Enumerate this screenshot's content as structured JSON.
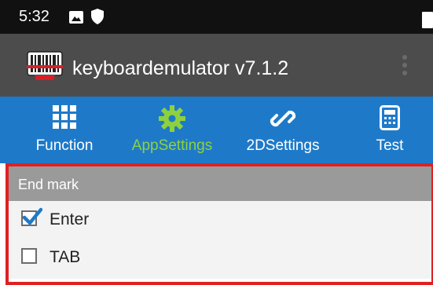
{
  "status_bar": {
    "time": "5:32",
    "icons": [
      "image-icon",
      "shield-icon",
      "battery-icon"
    ]
  },
  "app_bar": {
    "title": "keyboardemulator v7.1.2",
    "logo_icon": "barcode-scanner-icon",
    "menu_icon": "overflow-menu-icon"
  },
  "tabs": [
    {
      "label": "Function",
      "icon": "grid-icon",
      "active": false
    },
    {
      "label": "AppSettings",
      "icon": "gear-icon",
      "active": true
    },
    {
      "label": "2DSettings",
      "icon": "link-icon",
      "active": false
    },
    {
      "label": "Test",
      "icon": "calculator-icon",
      "active": false
    }
  ],
  "end_mark": {
    "title": "End mark",
    "options": [
      {
        "label": "Enter",
        "checked": true
      },
      {
        "label": "TAB",
        "checked": false
      }
    ]
  },
  "colors": {
    "status_bar": "#111111",
    "app_bar": "#4c4c4c",
    "tab_bar": "#1e7ac9",
    "active_tab": "#8fd13d",
    "section_header": "#9a9a9a",
    "highlight_border": "#e02020",
    "checkbox_checked": "#1e7ac9"
  }
}
